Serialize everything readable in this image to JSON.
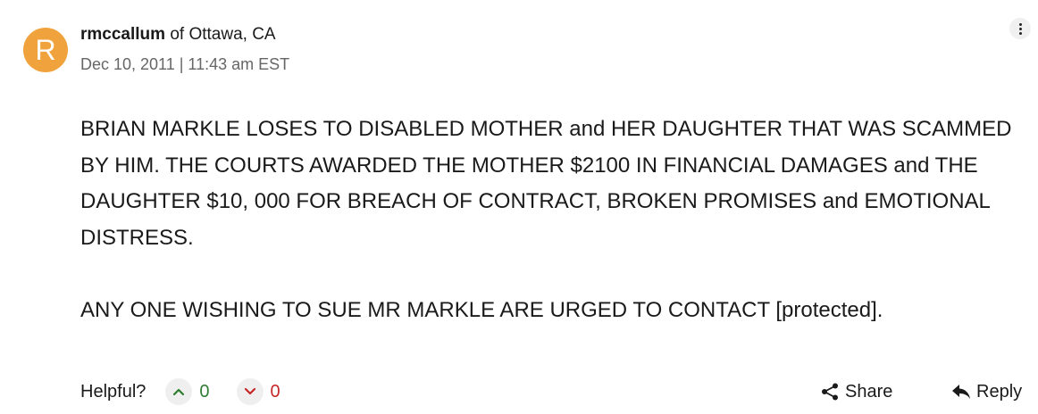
{
  "review": {
    "avatar_letter": "R",
    "author": "rmccallum",
    "location_text": " of Ottawa, CA",
    "date": "Dec 10, 2011 | 11:43 am EST",
    "paragraphs": [
      "BRIAN MARKLE LOSES TO DISABLED MOTHER and HER DAUGHTER THAT WAS SCAMMED BY HIM. THE COURTS AWARDED THE MOTHER $2100 IN FINANCIAL DAMAGES and THE DAUGHTER $10, 000 FOR BREACH OF CONTRACT, BROKEN PROMISES and EMOTIONAL DISTRESS.",
      "ANY ONE WISHING TO SUE MR MARKLE ARE URGED TO CONTACT [protected]."
    ]
  },
  "footer": {
    "helpful_label": "Helpful?",
    "upvotes": "0",
    "downvotes": "0",
    "share_label": "Share",
    "reply_label": "Reply"
  },
  "colors": {
    "avatar_bg": "#f0a33c",
    "upvote": "#2e7d32",
    "downvote": "#c62828",
    "meta_text": "#666666"
  },
  "icons": {
    "more": "vertical-ellipsis-icon",
    "upvote": "chevron-up-icon",
    "downvote": "chevron-down-icon",
    "share": "share-icon",
    "reply": "reply-arrow-icon"
  }
}
